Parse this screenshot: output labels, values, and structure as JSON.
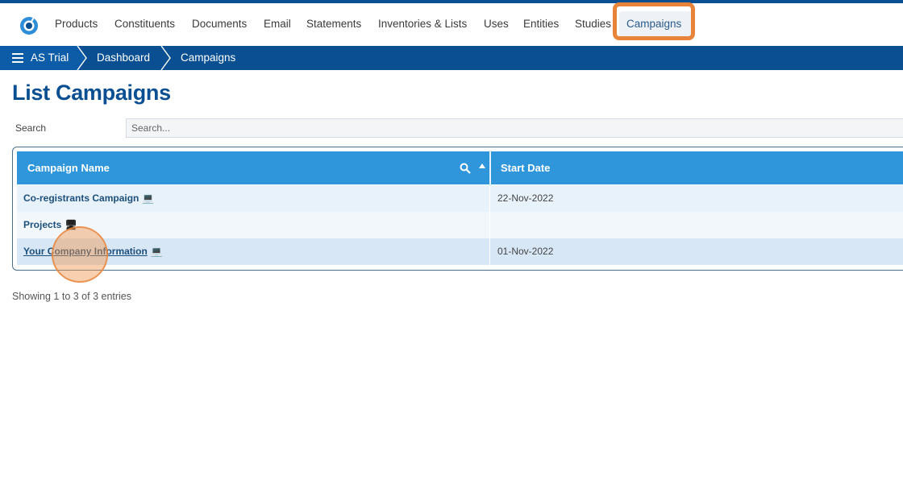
{
  "topnav": {
    "logo_icon": "app-logo-icon",
    "items": [
      "Products",
      "Constituents",
      "Documents",
      "Email",
      "Statements",
      "Inventories & Lists",
      "Uses",
      "Entities",
      "Studies",
      "Campaigns"
    ],
    "active": "Campaigns"
  },
  "breadcrumb": {
    "menu_icon": "hamburger-icon",
    "items": [
      "AS Trial",
      "Dashboard",
      "Campaigns"
    ]
  },
  "page": {
    "title": "List Campaigns"
  },
  "search": {
    "label": "Search",
    "placeholder": "Search..."
  },
  "table": {
    "columns": [
      "Campaign Name",
      "Start Date"
    ],
    "sort_icon": "sort-ascending-icon",
    "search_icon": "search-icon",
    "rows": [
      {
        "name": "Co-registrants Campaign",
        "icon": "laptop-icon",
        "start_date": "22-Nov-2022"
      },
      {
        "name": "Projects",
        "icon": "monitor-icon",
        "start_date": ""
      },
      {
        "name": "Your Company Information",
        "icon": "laptop-icon",
        "start_date": "01-Nov-2022"
      }
    ]
  },
  "footer": {
    "info": "Showing 1 to 3 of 3 entries"
  },
  "colors": {
    "brand_dark": "#0a4f91",
    "header_blue": "#2f96dc",
    "highlight_orange": "#e8843a"
  }
}
